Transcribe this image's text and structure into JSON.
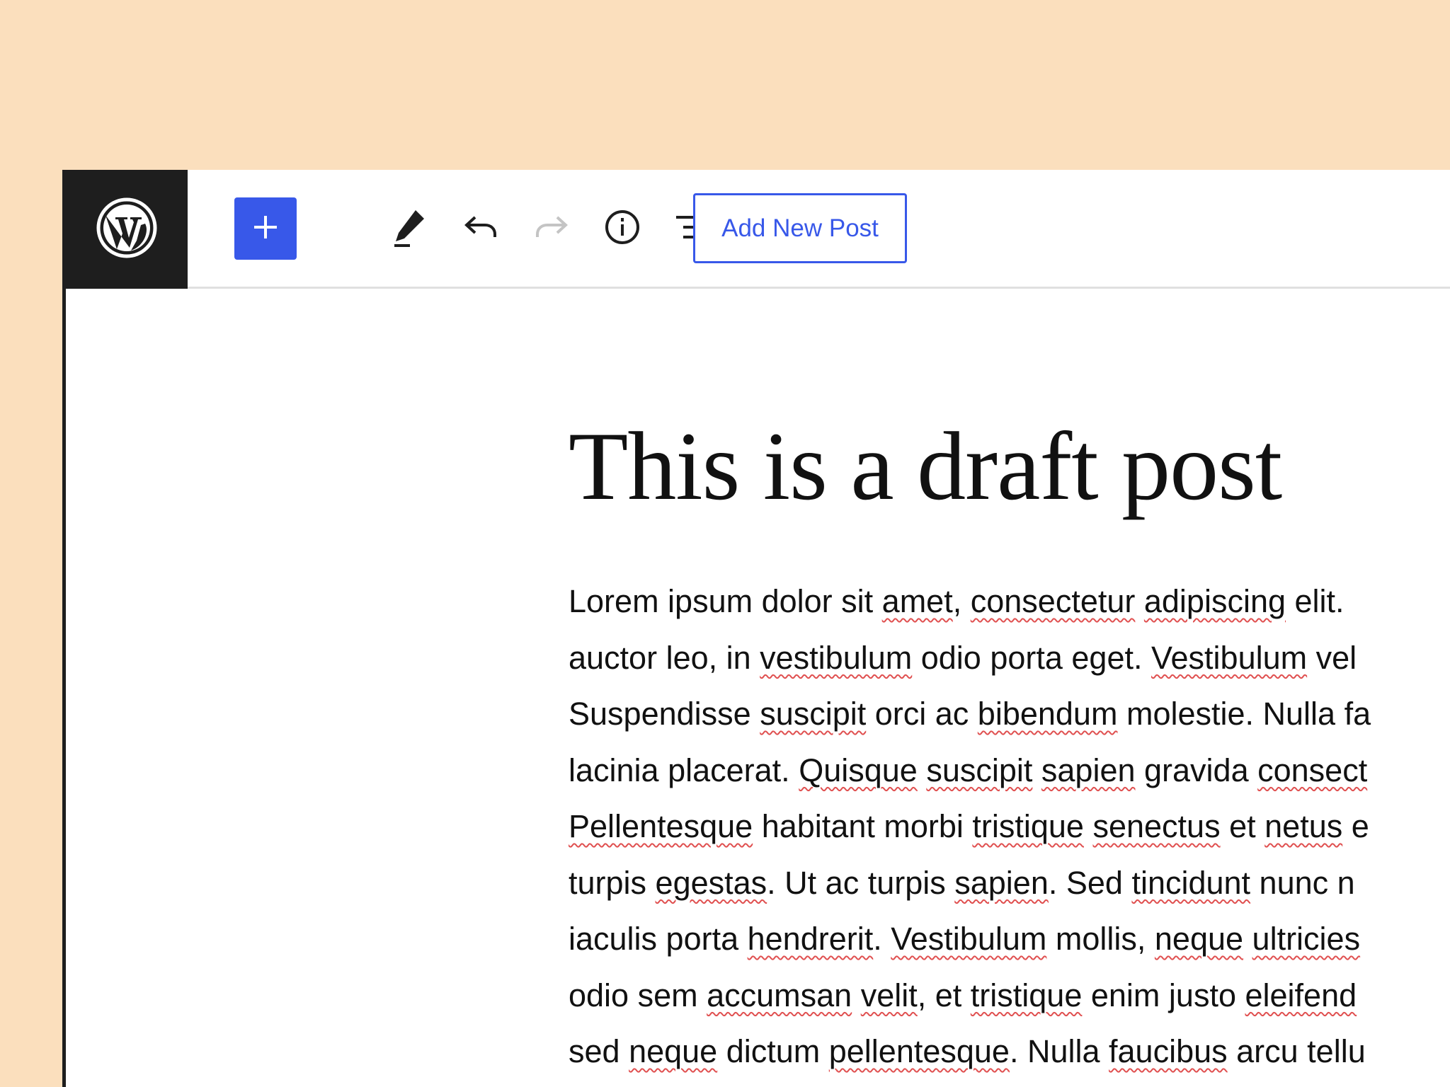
{
  "toolbar": {
    "add_new_post_label": "Add New Post"
  },
  "icons": {
    "logo": "wordpress-logo-icon",
    "add": "plus-icon",
    "tools": "pencil-icon",
    "undo": "undo-icon",
    "redo": "redo-icon",
    "details": "info-icon",
    "outline": "list-view-icon"
  },
  "colors": {
    "background": "#fbdfbd",
    "accent": "#3858e9",
    "logo_bg": "#1e1e1e",
    "spellcheck": "#e05050"
  },
  "post": {
    "title": "This is a draft post",
    "body_lines": [
      [
        {
          "t": "Lorem ipsum dolor sit ",
          "s": false
        },
        {
          "t": "amet",
          "s": true
        },
        {
          "t": ", ",
          "s": false
        },
        {
          "t": "consectetur",
          "s": true
        },
        {
          "t": " ",
          "s": false
        },
        {
          "t": "adipiscing",
          "s": true
        },
        {
          "t": " elit. ",
          "s": false
        }
      ],
      [
        {
          "t": "auctor leo, in ",
          "s": false
        },
        {
          "t": "vestibulum",
          "s": true
        },
        {
          "t": " odio porta eget. ",
          "s": false
        },
        {
          "t": "Vestibulum",
          "s": true
        },
        {
          "t": " vel",
          "s": false
        }
      ],
      [
        {
          "t": "Suspendisse ",
          "s": false
        },
        {
          "t": "suscipit",
          "s": true
        },
        {
          "t": " orci ac ",
          "s": false
        },
        {
          "t": "bibendum",
          "s": true
        },
        {
          "t": " molestie. Nulla fa",
          "s": false
        }
      ],
      [
        {
          "t": "lacinia placerat. ",
          "s": false
        },
        {
          "t": "Quisque",
          "s": true
        },
        {
          "t": " ",
          "s": false
        },
        {
          "t": "suscipit",
          "s": true
        },
        {
          "t": " ",
          "s": false
        },
        {
          "t": "sapien",
          "s": true
        },
        {
          "t": " gravida ",
          "s": false
        },
        {
          "t": "consect",
          "s": true
        }
      ],
      [
        {
          "t": "Pellentesque",
          "s": true
        },
        {
          "t": " habitant morbi ",
          "s": false
        },
        {
          "t": "tristique",
          "s": true
        },
        {
          "t": " ",
          "s": false
        },
        {
          "t": "senectus",
          "s": true
        },
        {
          "t": " et ",
          "s": false
        },
        {
          "t": "netus",
          "s": true
        },
        {
          "t": " e",
          "s": false
        }
      ],
      [
        {
          "t": "turpis ",
          "s": false
        },
        {
          "t": "egestas",
          "s": true
        },
        {
          "t": ". Ut ac turpis ",
          "s": false
        },
        {
          "t": "sapien",
          "s": true
        },
        {
          "t": ". Sed ",
          "s": false
        },
        {
          "t": "tincidunt",
          "s": true
        },
        {
          "t": " nunc n",
          "s": false
        }
      ],
      [
        {
          "t": "iaculis porta ",
          "s": false
        },
        {
          "t": "hendrerit",
          "s": true
        },
        {
          "t": ". ",
          "s": false
        },
        {
          "t": "Vestibulum",
          "s": true
        },
        {
          "t": " mollis, ",
          "s": false
        },
        {
          "t": "neque",
          "s": true
        },
        {
          "t": " ",
          "s": false
        },
        {
          "t": "ultricies",
          "s": true
        }
      ],
      [
        {
          "t": "odio sem ",
          "s": false
        },
        {
          "t": "accumsan",
          "s": true
        },
        {
          "t": " ",
          "s": false
        },
        {
          "t": "velit",
          "s": true
        },
        {
          "t": ", et ",
          "s": false
        },
        {
          "t": "tristique",
          "s": true
        },
        {
          "t": " enim justo ",
          "s": false
        },
        {
          "t": "eleifend",
          "s": true
        }
      ],
      [
        {
          "t": "sed ",
          "s": false
        },
        {
          "t": "neque",
          "s": true
        },
        {
          "t": " dictum ",
          "s": false
        },
        {
          "t": "pellentesque",
          "s": true
        },
        {
          "t": ". Nulla ",
          "s": false
        },
        {
          "t": "faucibus",
          "s": true
        },
        {
          "t": " arcu tellu",
          "s": false
        }
      ]
    ]
  }
}
